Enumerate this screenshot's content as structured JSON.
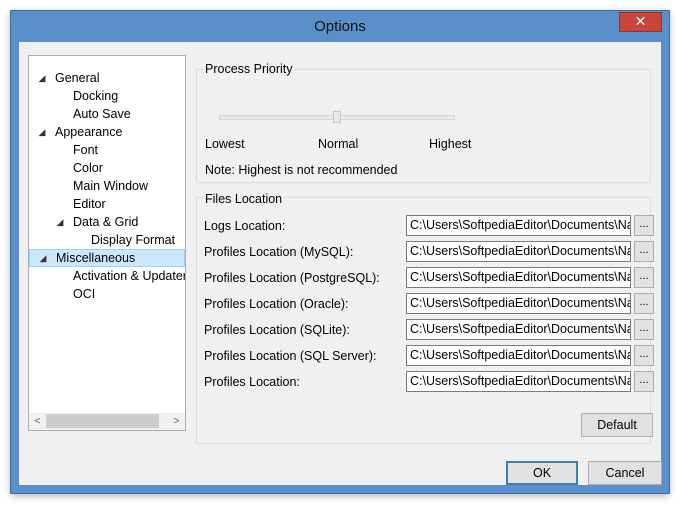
{
  "window": {
    "title": "Options",
    "close_glyph": "✕"
  },
  "tree": {
    "items": [
      {
        "label": "General",
        "expander": "◢",
        "level": 0
      },
      {
        "label": "Docking",
        "level": 1
      },
      {
        "label": "Auto Save",
        "level": 1
      },
      {
        "label": "Appearance",
        "expander": "◢",
        "level": 0
      },
      {
        "label": "Font",
        "level": 1
      },
      {
        "label": "Color",
        "level": 1
      },
      {
        "label": "Main Window",
        "level": 1
      },
      {
        "label": "Editor",
        "level": 1
      },
      {
        "label": "Data & Grid",
        "expander": "◢",
        "level": 1
      },
      {
        "label": "Display Format",
        "level": 2
      },
      {
        "label": "Miscellaneous",
        "expander": "◢",
        "level": 0,
        "selected": true
      },
      {
        "label": "Activation & Updater",
        "level": 1
      },
      {
        "label": "OCI",
        "level": 1
      }
    ],
    "scroll_left": "<",
    "scroll_right": ">"
  },
  "process_priority": {
    "title": "Process Priority",
    "labels": {
      "low": "Lowest",
      "mid": "Normal",
      "high": "Highest"
    },
    "value": "Normal",
    "note": "Note: Highest is not recommended"
  },
  "files_location": {
    "title": "Files Location",
    "rows": [
      {
        "label": "Logs Location:",
        "value": "C:\\Users\\SoftpediaEditor\\Documents\\Nav"
      },
      {
        "label": "Profiles Location (MySQL):",
        "value": "C:\\Users\\SoftpediaEditor\\Documents\\Nav"
      },
      {
        "label": "Profiles Location (PostgreSQL):",
        "value": "C:\\Users\\SoftpediaEditor\\Documents\\Nav"
      },
      {
        "label": "Profiles Location (Oracle):",
        "value": "C:\\Users\\SoftpediaEditor\\Documents\\Nav"
      },
      {
        "label": "Profiles Location (SQLite):",
        "value": "C:\\Users\\SoftpediaEditor\\Documents\\Nav"
      },
      {
        "label": "Profiles Location (SQL Server):",
        "value": "C:\\Users\\SoftpediaEditor\\Documents\\Nav"
      },
      {
        "label": "Profiles Location:",
        "value": "C:\\Users\\SoftpediaEditor\\Documents\\Nav"
      }
    ],
    "browse_label": "...",
    "default_button": "Default"
  },
  "footer": {
    "ok": "OK",
    "cancel": "Cancel"
  }
}
